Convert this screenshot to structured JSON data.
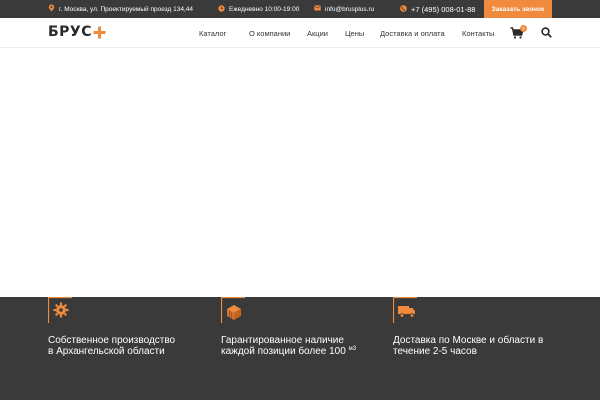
{
  "topbar": {
    "address": "г. Москва, ул. Проектируемый проезд 134,44",
    "hours": "Ежедневно 10:00-19:00",
    "email": "info@brusplus.ru",
    "phone": "+7 (495) 008-01-88",
    "callback_label": "Заказать звонок",
    "icons": [
      "location-icon",
      "clock-icon",
      "mail-icon",
      "phone-icon"
    ]
  },
  "header": {
    "logo_text": "БРУС",
    "nav": [
      "Каталог",
      "О компании",
      "Акции",
      "Цены",
      "Доставка и оплата",
      "Контакты"
    ],
    "cart_count": "0"
  },
  "features": [
    {
      "line1": "Собственное производство",
      "line2": "в Архангельской области",
      "icon": "gear-icon"
    },
    {
      "line1": "Гарантированное наличие",
      "line2": "каждой позиции более 100",
      "sup": "м3",
      "icon": "lumber-stack-icon"
    },
    {
      "line1": "Доставка по Москве и области в",
      "line2": "течение 2-5 часов",
      "icon": "truck-icon"
    }
  ],
  "colors": {
    "accent": "#f08a3c",
    "dark": "#3a3a3a"
  }
}
